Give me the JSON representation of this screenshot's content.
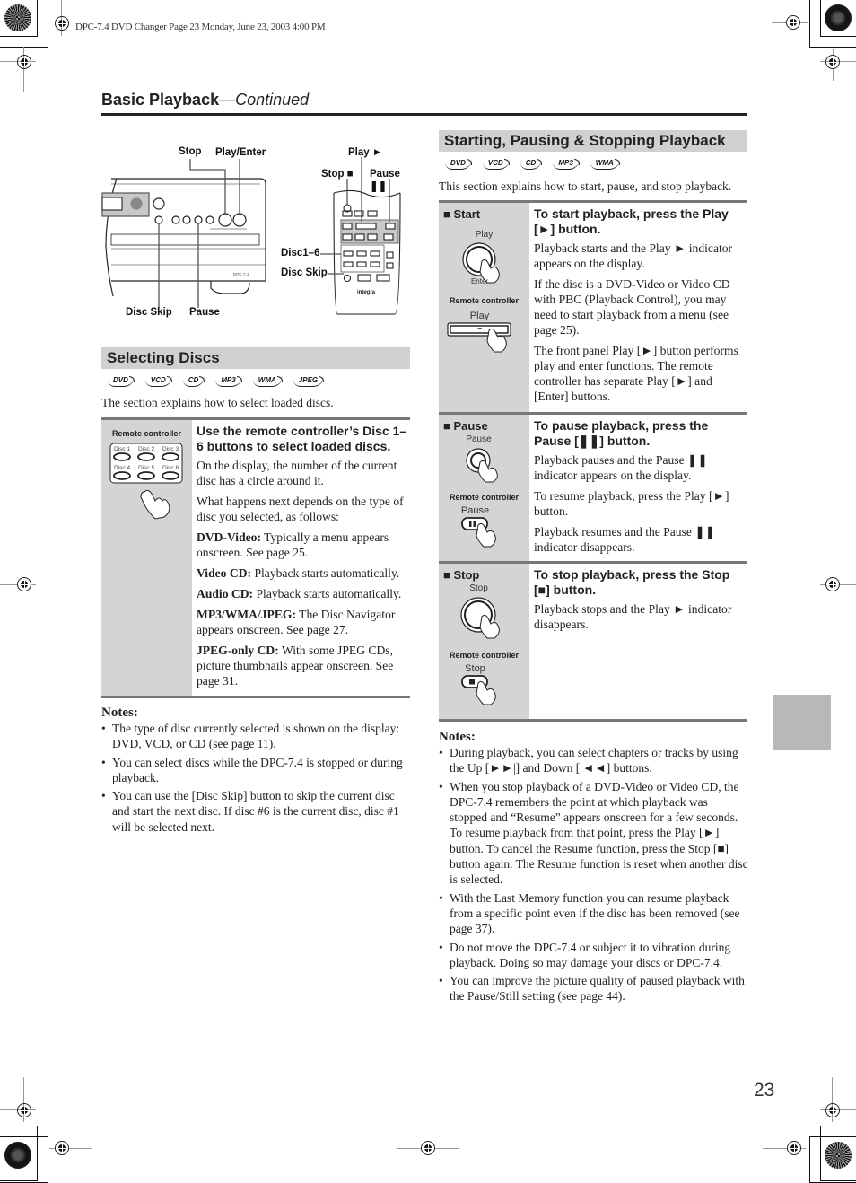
{
  "print_header": "DPC-7.4 DVD Changer Page 23  Monday, June 23, 2003  4:00 PM",
  "page_title": {
    "main": "Basic Playback",
    "suffix": "—Continued"
  },
  "illustration": {
    "unit_callouts": {
      "stop": "Stop",
      "play_enter": "Play/Enter",
      "disc_skip": "Disc Skip",
      "pause": "Pause"
    },
    "remote_callouts": {
      "play": "Play ►",
      "stop": "Stop ■",
      "pause": "Pause ❚❚",
      "disc_1_6": "Disc1–6",
      "disc_skip": "Disc Skip"
    },
    "unit_model": "DPC-7.4",
    "remote_brand": "integra"
  },
  "selecting_discs": {
    "title": "Selecting Discs",
    "disc_types": [
      "DVD",
      "VCD",
      "CD",
      "MP3",
      "WMA",
      "JPEG"
    ],
    "intro": "The section explains how to select loaded discs.",
    "left_label": "Remote controller",
    "disc_buttons": [
      "Disc 1",
      "Disc 2",
      "Disc 3",
      "Disc 4",
      "Disc 5",
      "Disc 6"
    ],
    "heading": "Use the remote controller’s Disc 1–6 buttons to select loaded discs.",
    "paragraphs": [
      {
        "bold": "",
        "text": "On the display, the number of the current disc has a circle around it."
      },
      {
        "bold": "",
        "text": "What happens next depends on the type of disc you selected, as follows:"
      },
      {
        "bold": "DVD-Video:",
        "text": " Typically a menu appears onscreen. See page 25."
      },
      {
        "bold": "Video CD:",
        "text": " Playback starts automatically."
      },
      {
        "bold": "Audio CD:",
        "text": " Playback starts automatically."
      },
      {
        "bold": "MP3/WMA/JPEG:",
        "text": " The Disc Navigator appears onscreen. See page 27."
      },
      {
        "bold": "JPEG-only CD:",
        "text": " With some JPEG CDs, picture thumbnails appear onscreen. See page 31."
      }
    ],
    "notes_title": "Notes:",
    "notes": [
      "The type of disc currently selected is shown on the display: DVD, VCD, or CD (see page 11).",
      "You can select discs while the DPC-7.4 is stopped or during playback.",
      "You can use the [Disc Skip] button to skip the current disc and start the next disc. If disc #6 is the current disc, disc #1 will be selected next."
    ]
  },
  "playback": {
    "title": "Starting, Pausing & Stopping Playback",
    "disc_types": [
      "DVD",
      "VCD",
      "CD",
      "MP3",
      "WMA"
    ],
    "intro": "This section explains how to start, pause, and stop playback.",
    "remote_label": "Remote controller",
    "rows": [
      {
        "title": "Start",
        "unit_button_label": "Play",
        "unit_button_sublabel": "Enter",
        "remote_button_label": "Play",
        "heading": "To start playback, press the Play [►] button.",
        "paragraphs": [
          "Playback starts and the Play ► indicator appears on the display.",
          "If the disc is a DVD-Video or Video CD with PBC (Playback Control), you may need to start playback from a menu (see page 25).",
          "The front panel Play [►] button performs play and enter functions. The remote controller has separate Play [►] and [Enter] buttons."
        ]
      },
      {
        "title": "Pause",
        "unit_button_label": "Pause",
        "remote_button_label": "Pause",
        "heading": "To pause playback, press the Pause [❚❚] button.",
        "paragraphs": [
          "Playback pauses and the Pause ❚❚ indicator appears on the display.",
          "To resume playback, press the Play [►] button.",
          "Playback resumes and the Pause ❚❚ indicator disappears."
        ]
      },
      {
        "title": "Stop",
        "unit_button_label": "Stop",
        "remote_button_label": "Stop",
        "heading": "To stop playback, press the Stop [■] button.",
        "paragraphs": [
          "Playback stops and the Play ► indicator disappears."
        ]
      }
    ],
    "notes_title": "Notes:",
    "notes": [
      "During playback, you can select chapters or tracks by using the Up [►►|] and Down [|◄◄] buttons.",
      "When you stop playback of a DVD-Video or Video CD, the DPC-7.4 remembers the point at which playback was stopped and “Resume” appears onscreen for a few seconds. To resume playback from that point, press the Play [►] button. To cancel the Resume function, press the Stop [■] button again. The Resume function is reset when another disc is selected.",
      "With the Last Memory function you can resume playback from a specific point even if the disc has been removed (see page 37).",
      "Do not move the DPC-7.4 or subject it to vibration during playback. Doing so may damage your discs or DPC-7.4.",
      "You can improve the picture quality of paused playback with the Pause/Still setting (see page 44)."
    ]
  },
  "page_number": "23",
  "colors": {
    "section_bg": "#d0d0d0",
    "table_left_bg": "#d4d4d4",
    "rule": "#777777",
    "side_tab": "#b8b8b8"
  }
}
